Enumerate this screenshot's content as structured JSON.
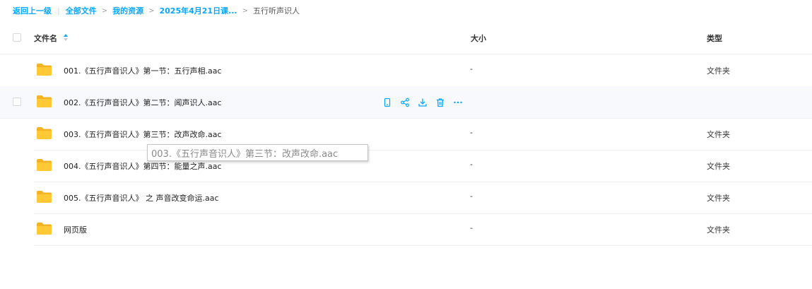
{
  "breadcrumb": {
    "back": "返回上一级",
    "items": [
      "全部文件",
      "我的资源",
      "2025年4月21日课..."
    ],
    "current": "五行听声识人"
  },
  "header": {
    "name_col": "文件名",
    "size_col": "大小",
    "type_col": "类型"
  },
  "files": [
    {
      "name": "001.《五行声音识人》第一节：五行声相.aac",
      "size": "-",
      "type": "文件夹"
    },
    {
      "name": "002.《五行声音识人》第二节：闻声识人.aac",
      "size": "",
      "type": ""
    },
    {
      "name": "003.《五行声音识人》第三节：改声改命.aac",
      "size": "-",
      "type": "文件夹"
    },
    {
      "name": "004.《五行声音识人》第四节：能量之声.aac",
      "size": "-",
      "type": "文件夹"
    },
    {
      "name": "005.《五行声音识人》 之 声音改变命运.aac",
      "size": "-",
      "type": "文件夹"
    },
    {
      "name": "网页版",
      "size": "-",
      "type": "文件夹"
    }
  ],
  "tooltip": "003.《五行声音识人》第三节：改声改命.aac",
  "icons": {
    "folder": "folder-icon",
    "actions": [
      "phone-icon",
      "share-icon",
      "download-icon",
      "delete-icon",
      "more-icon"
    ]
  },
  "colors": {
    "accent": "#06a7ff",
    "folder": "#ffc936",
    "hover_row": "#f7f9fc"
  }
}
